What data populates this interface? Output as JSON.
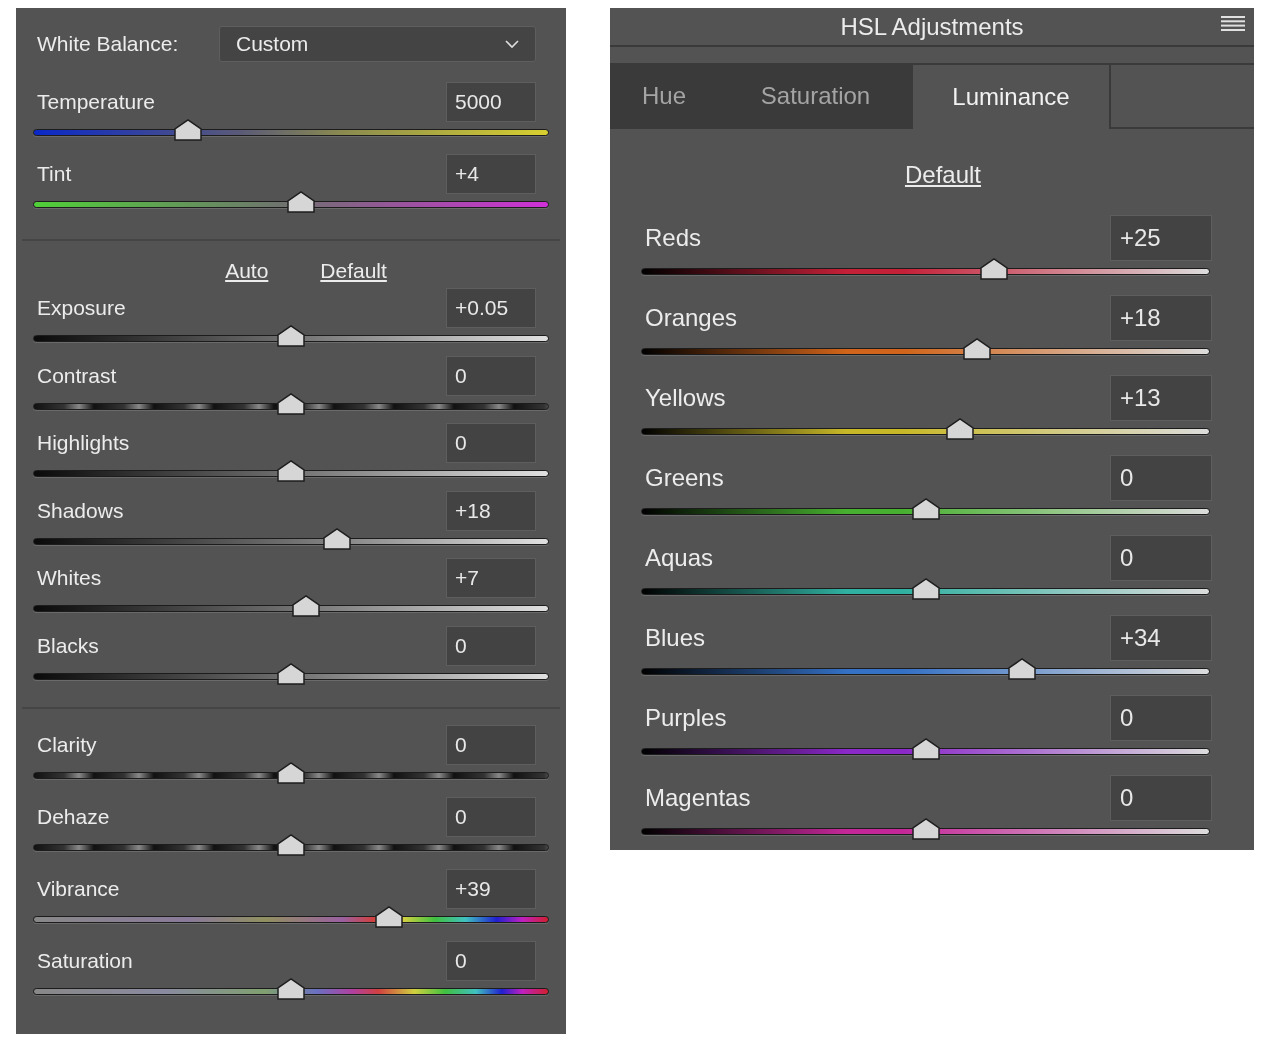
{
  "basic_panel": {
    "white_balance": {
      "label": "White Balance:",
      "value": "Custom"
    },
    "groups": [
      {
        "sliders": [
          {
            "label": "Temperature",
            "value": "5000",
            "kind": "temperature",
            "level": 0.3
          },
          {
            "label": "Tint",
            "value": "+4",
            "kind": "tint",
            "level": 0.52
          }
        ]
      },
      {
        "links": [
          "Auto",
          "Default"
        ],
        "sliders": [
          {
            "label": "Exposure",
            "value": "+0.05",
            "kind": "tone",
            "level": 0.5
          },
          {
            "label": "Contrast",
            "value": "0",
            "kind": "contrast",
            "level": 0.5
          },
          {
            "label": "Highlights",
            "value": "0",
            "kind": "tone",
            "level": 0.5
          },
          {
            "label": "Shadows",
            "value": "+18",
            "kind": "tone",
            "level": 0.59
          },
          {
            "label": "Whites",
            "value": "+7",
            "kind": "tone",
            "level": 0.53
          },
          {
            "label": "Blacks",
            "value": "0",
            "kind": "tone",
            "level": 0.5
          }
        ]
      },
      {
        "sliders": [
          {
            "label": "Clarity",
            "value": "0",
            "kind": "contrast",
            "level": 0.5
          },
          {
            "label": "Dehaze",
            "value": "0",
            "kind": "contrast",
            "level": 0.5
          },
          {
            "label": "Vibrance",
            "value": "+39",
            "kind": "vibrance",
            "level": 0.69
          },
          {
            "label": "Saturation",
            "value": "0",
            "kind": "saturation",
            "level": 0.5
          }
        ]
      }
    ]
  },
  "hsl_panel": {
    "title": "HSL Adjustments",
    "tabs": [
      {
        "label": "Hue",
        "selected": false
      },
      {
        "label": "Saturation",
        "selected": false
      },
      {
        "label": "Luminance",
        "selected": true
      }
    ],
    "link": "Default",
    "sliders": [
      {
        "label": "Reds",
        "value": "+25",
        "color": "#c42038",
        "level": 0.62
      },
      {
        "label": "Oranges",
        "value": "+18",
        "color": "#d0641a",
        "level": 0.59
      },
      {
        "label": "Yellows",
        "value": "+13",
        "color": "#c8b828",
        "level": 0.56
      },
      {
        "label": "Greens",
        "value": "0",
        "color": "#48b030",
        "level": 0.5
      },
      {
        "label": "Aquas",
        "value": "0",
        "color": "#30b0a0",
        "level": 0.5
      },
      {
        "label": "Blues",
        "value": "+34",
        "color": "#3470c4",
        "level": 0.67
      },
      {
        "label": "Purples",
        "value": "0",
        "color": "#8a28c8",
        "level": 0.5
      },
      {
        "label": "Magentas",
        "value": "0",
        "color": "#c42898",
        "level": 0.5
      }
    ]
  }
}
